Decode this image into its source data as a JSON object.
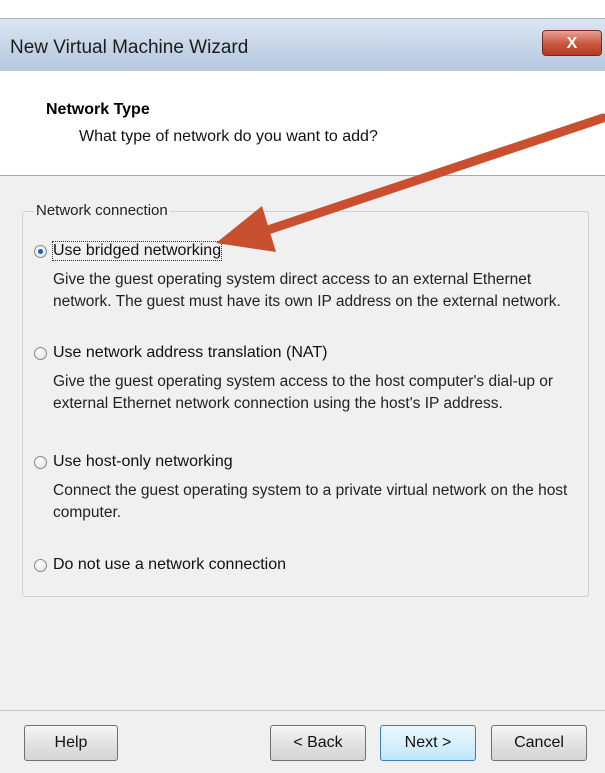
{
  "window": {
    "title": "New Virtual Machine Wizard",
    "close_label": "X"
  },
  "header": {
    "title": "Network Type",
    "subtitle": "What type of network do you want to add?"
  },
  "network": {
    "group_label": "Network connection",
    "options": [
      {
        "label": "Use bridged networking",
        "selected": true,
        "description": "Give the guest operating system direct access to an external Ethernet network. The guest must have its own IP address on the external network."
      },
      {
        "label": "Use network address translation (NAT)",
        "selected": false,
        "description": "Give the guest operating system access to the host computer's dial-up or external Ethernet network connection using the host's IP address."
      },
      {
        "label": "Use host-only networking",
        "selected": false,
        "description": "Connect the guest operating system to a private virtual network on the host computer."
      },
      {
        "label": "Do not use a network connection",
        "selected": false,
        "description": ""
      }
    ]
  },
  "buttons": {
    "help": "Help",
    "back": "< Back",
    "next": "Next >",
    "cancel": "Cancel"
  },
  "colors": {
    "annotation_arrow": "#c8502e",
    "selected_radio": "#1a5fb4",
    "close_button": "#c8553d"
  }
}
